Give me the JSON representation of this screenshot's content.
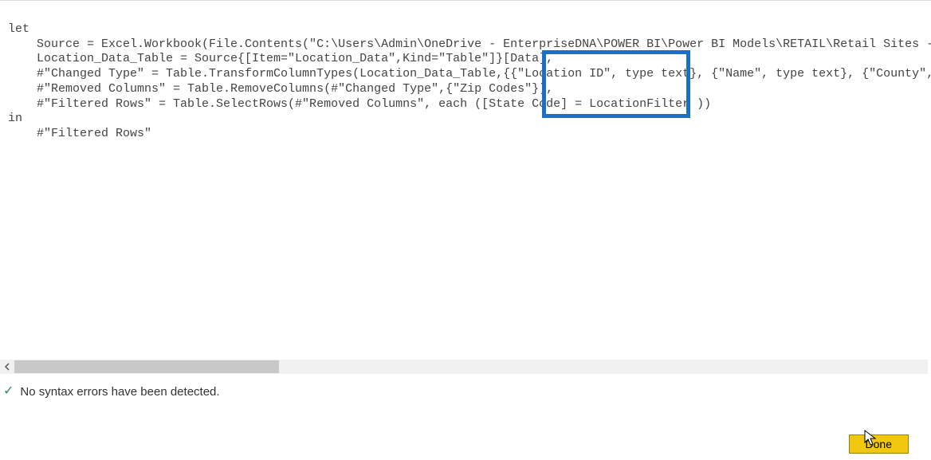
{
  "code": {
    "line1": "let",
    "line2": "    Source = Excel.Workbook(File.Contents(\"C:\\Users\\Admin\\OneDrive - EnterpriseDNA\\POWER BI\\Power BI Models\\RETAIL\\Retail Sites - Data",
    "line3": "    Location_Data_Table = Source{[Item=\"Location_Data\",Kind=\"Table\"]}[Data],",
    "line4": "    #\"Changed Type\" = Table.TransformColumnTypes(Location_Data_Table,{{\"Location ID\", type text}, {\"Name\", type text}, {\"County\", type",
    "line5": "    #\"Removed Columns\" = Table.RemoveColumns(#\"Changed Type\",{\"Zip Codes\"}),",
    "line6": "    #\"Filtered Rows\" = Table.SelectRows(#\"Removed Columns\", each ([State Code] = LocationFilter ))",
    "line7": "in",
    "line8": "    #\"Filtered Rows\""
  },
  "status": {
    "message": "No syntax errors have been detected."
  },
  "footer": {
    "done_label": "Done"
  },
  "highlight": {
    "target_text": "= LocationFilter"
  }
}
